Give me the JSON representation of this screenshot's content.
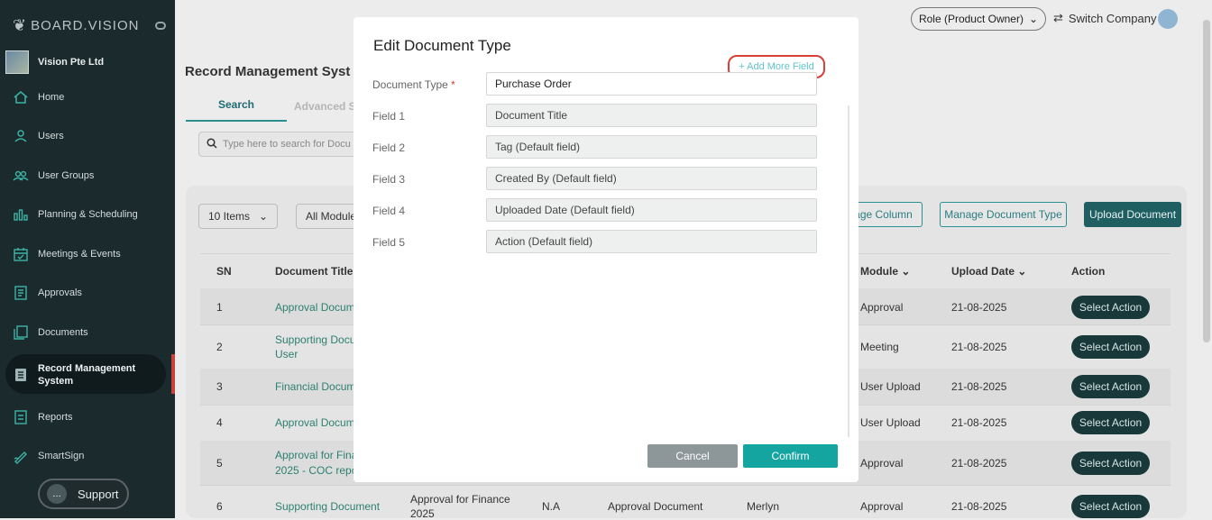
{
  "app": {
    "logo_text": "BOARD.VISION",
    "company": "Vision Pte Ltd"
  },
  "sidebar": {
    "items": [
      {
        "label": "Home",
        "icon": "home-icon"
      },
      {
        "label": "Users",
        "icon": "user-icon"
      },
      {
        "label": "User Groups",
        "icon": "users-icon"
      },
      {
        "label": "Planning & Scheduling",
        "icon": "chart-icon"
      },
      {
        "label": "Meetings & Events",
        "icon": "calendar-icon"
      },
      {
        "label": "Approvals",
        "icon": "approvals-icon"
      },
      {
        "label": "Documents",
        "icon": "documents-icon"
      },
      {
        "label": "Record Management System",
        "icon": "record-icon"
      },
      {
        "label": "Reports",
        "icon": "reports-icon"
      },
      {
        "label": "SmartSign",
        "icon": "pen-icon"
      }
    ],
    "support_label": "Support"
  },
  "topbar": {
    "role": "Role (Product Owner)",
    "switch_company": "Switch Company"
  },
  "page": {
    "title": "Record Management Syst",
    "tab_search": "Search",
    "tab_advanced": "Advanced S",
    "search_placeholder": "Type here to search for Docu",
    "items_select": "10 Items",
    "module_select": "All Module",
    "btn_manage_column": "age Column",
    "btn_manage_doc_type": "Manage Document Type",
    "btn_upload": "Upload Document"
  },
  "table": {
    "headers": {
      "sn": "SN",
      "doc_title": "Document Title",
      "module": "Module",
      "upload_date": "Upload Date",
      "action": "Action"
    },
    "rows": [
      {
        "sn": "1",
        "title": "Approval Docume",
        "title2": "",
        "module": "Approval",
        "date": "21-08-2025",
        "action": "Select Action"
      },
      {
        "sn": "2",
        "title": "Supporting Docu",
        "title2": "User",
        "module": "Meeting",
        "date": "21-08-2025",
        "action": "Select Action"
      },
      {
        "sn": "3",
        "title": "Financial Docume",
        "title2": "",
        "module": "User Upload",
        "date": "21-08-2025",
        "action": "Select Action"
      },
      {
        "sn": "4",
        "title": "Approval Docume",
        "title2": "",
        "module": "User Upload",
        "date": "21-08-2025",
        "action": "Select Action"
      },
      {
        "sn": "5",
        "title": "Approval for Fina",
        "title2": "2025 - COC repo",
        "module": "Approval",
        "date": "21-08-2025",
        "action": "Select Action"
      },
      {
        "sn": "6",
        "title": "Supporting Document",
        "title2": "",
        "extra1": "Approval for Finance",
        "extra1b": "2025",
        "extra2": "N.A",
        "extra3": "Approval Document",
        "extra4": "Merlyn",
        "module": "Approval",
        "date": "21-08-2025",
        "action": "Select Action"
      }
    ]
  },
  "modal": {
    "title": "Edit Document Type",
    "add_more_field": "+ Add More Field",
    "doc_type_label": "Document Type",
    "required_star": "*",
    "doc_type_value": "Purchase Order",
    "fields": [
      {
        "label": "Field 1",
        "value": "Document Title"
      },
      {
        "label": "Field 2",
        "value": "Tag (Default field)"
      },
      {
        "label": "Field 3",
        "value": "Created By (Default field)"
      },
      {
        "label": "Field 4",
        "value": "Uploaded Date (Default field)"
      },
      {
        "label": "Field 5",
        "value": "Action (Default field)"
      }
    ],
    "cancel": "Cancel",
    "confirm": "Confirm"
  }
}
